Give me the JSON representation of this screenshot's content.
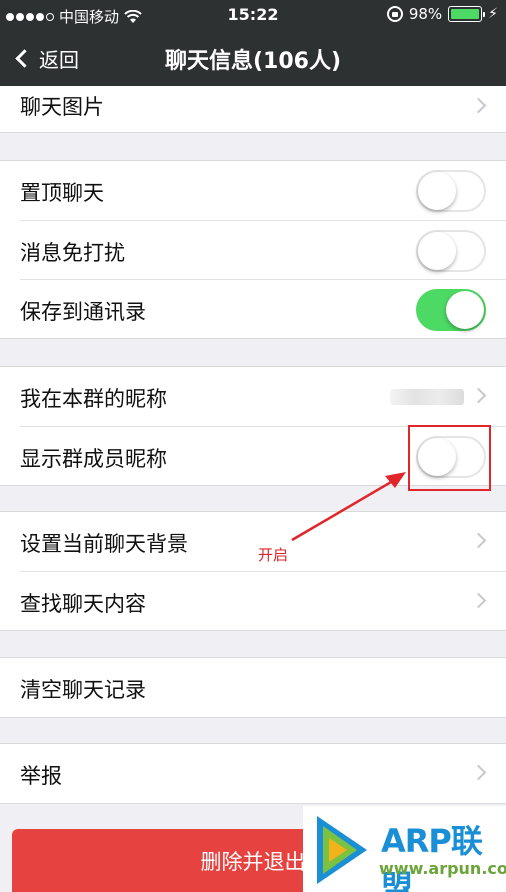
{
  "status_bar": {
    "carrier": "中国移动",
    "time": "15:22",
    "battery_percent": "98%",
    "battery_level": 0.98,
    "signal_bars": 4
  },
  "nav": {
    "back_label": "返回",
    "title": "聊天信息(106人)"
  },
  "groups": {
    "media": {
      "chat_images": "聊天图片"
    },
    "settings": {
      "pin_chat": {
        "label": "置顶聊天",
        "on": false
      },
      "mute": {
        "label": "消息免打扰",
        "on": false
      },
      "save_contacts": {
        "label": "保存到通讯录",
        "on": true
      }
    },
    "nickname": {
      "my_nickname": "我在本群的昵称",
      "show_member_nicknames": {
        "label": "显示群成员昵称",
        "on": false
      }
    },
    "chat": {
      "background": "设置当前聊天背景",
      "search": "查找聊天内容"
    },
    "clear": {
      "clear_history": "清空聊天记录"
    },
    "report": {
      "report": "举报"
    }
  },
  "annotation": {
    "text": "开启",
    "color": "#d9262a"
  },
  "delete_button": {
    "label": "删除并退出",
    "color": "#e64340"
  },
  "watermark": {
    "brand": "ARP联盟",
    "url": "www.arpun.com"
  },
  "colors": {
    "nav_bg": "#2e3132",
    "toggle_on": "#4cd964",
    "page_bg": "#efeff4"
  }
}
